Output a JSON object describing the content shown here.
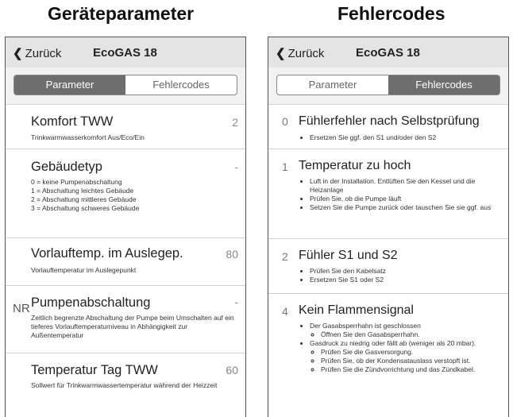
{
  "captions": {
    "left": "Geräteparameter",
    "right": "Fehlercodes"
  },
  "nav": {
    "back": "Zurück",
    "title": "EcoGAS 18"
  },
  "tabs": {
    "parameter": "Parameter",
    "fehlercodes": "Fehlercodes"
  },
  "parameters": [
    {
      "name": "Komfort TWW",
      "value": "2",
      "desc": "Trinkwarmwasserkomfort Aus/Eco/Ein"
    },
    {
      "name": "Gebäudetyp",
      "value": "-",
      "desc": "0 = keine Pumpenabschaltung\n1 = Abschaltung leichtes Gebäude\n2 = Abschaltung mittleres Gebäude\n3 = Abschaltung schweres Gebäude"
    },
    {
      "name": "Vorlauftemp. im Auslegep.",
      "value": "80",
      "desc": "Vorlauftemperatur im Auslegepunkt"
    },
    {
      "name": "Pumpenabschaltung",
      "value": "-",
      "desc": "Zeitlich begrenzte Abschaltung der Pumpe beim Umschalten auf ein tieferes Vorlauftemperaturniveau in Abhängigkeit zur Außentemperatur"
    },
    {
      "name": "Temperatur Tag TWW",
      "value": "60",
      "desc": "Sollwert für Trinkwarmwassertemperatur während der Heizzeit"
    }
  ],
  "overlay_text": "NR",
  "errors": [
    {
      "num": "0",
      "name": "Fühlerfehler nach Selbstprüfung",
      "items": [
        "Ersetzen Sie ggf. den S1 und/oder den S2"
      ]
    },
    {
      "num": "1",
      "name": "Temperatur zu hoch",
      "items": [
        "Luft in der Installation. Entlüften Sie den Kessel und die Heizanlage",
        "Prüfen Sie, ob die Pumpe läuft",
        "Setzen Sie die Pumpe zurück oder tauschen Sie sie ggf. aus"
      ]
    },
    {
      "num": "2",
      "name": "Fühler S1 und S2",
      "items": [
        "Prüfen Sie den Kabelsatz",
        "Ersetzen Sie S1 oder S2"
      ]
    },
    {
      "num": "4",
      "name": "Kein Flammensignal",
      "items": [
        "Der Gasabsperrhahn ist geschlossen",
        "Gasdruck zu niedrig oder fällt ab (weniger als 20 mbar)."
      ],
      "sub1": [
        "Öffnen Sie den Gasabsperrhahn."
      ],
      "sub2": [
        "Prüfen Sie die Gasversorgung.",
        "Prüfen Sie, ob der Kondensatauslass verstopft ist.",
        "Prüfen Sie die Zündvorrichtung und das Zündkabel."
      ]
    }
  ]
}
